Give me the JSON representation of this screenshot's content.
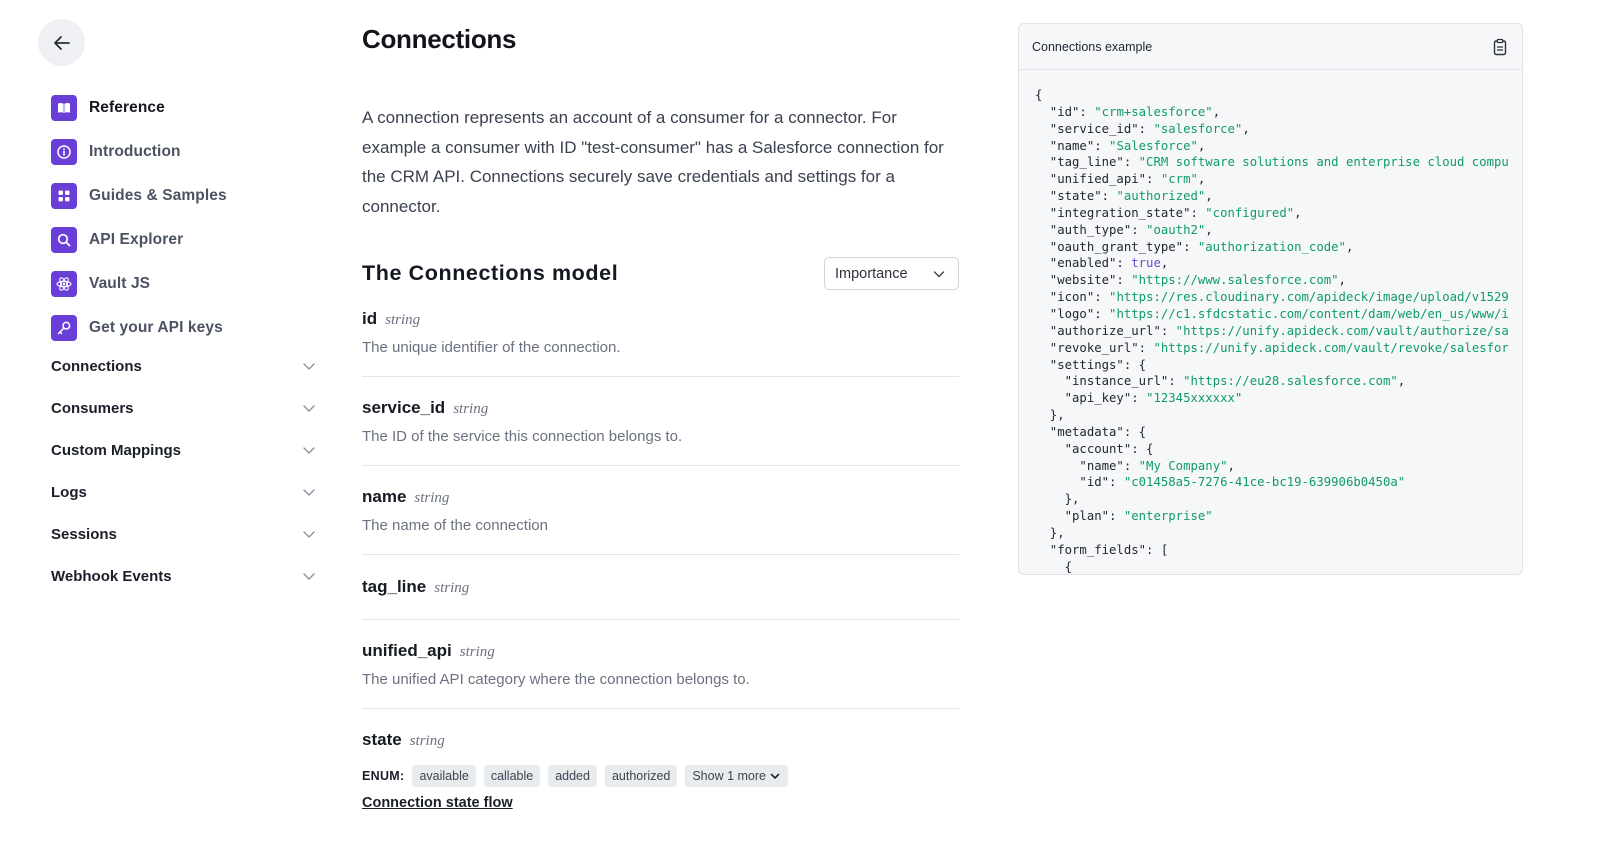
{
  "sidebar": {
    "nav": [
      {
        "label": "Reference",
        "icon": "book-icon",
        "active": true
      },
      {
        "label": "Introduction",
        "icon": "info-icon"
      },
      {
        "label": "Guides & Samples",
        "icon": "grid-icon"
      },
      {
        "label": "API Explorer",
        "icon": "search-icon"
      },
      {
        "label": "Vault JS",
        "icon": "atom-icon"
      },
      {
        "label": "Get your API keys",
        "icon": "key-icon"
      }
    ],
    "groups": [
      {
        "label": "Connections"
      },
      {
        "label": "Consumers"
      },
      {
        "label": "Custom Mappings"
      },
      {
        "label": "Logs"
      },
      {
        "label": "Sessions"
      },
      {
        "label": "Webhook Events"
      }
    ]
  },
  "main": {
    "title": "Connections",
    "intro": "A connection represents an account of a consumer for a connector. For example a consumer with ID \"test-consumer\" has a Salesforce connection for the CRM API. Connections securely save credentials and settings for a connector.",
    "model_title": "The Connections model",
    "sort_select": "Importance",
    "fields": [
      {
        "name": "id",
        "type": "string",
        "desc": "The unique identifier of the connection."
      },
      {
        "name": "service_id",
        "type": "string",
        "desc": "The ID of the service this connection belongs to."
      },
      {
        "name": "name",
        "type": "string",
        "desc": "The name of the connection"
      },
      {
        "name": "tag_line",
        "type": "string",
        "desc": ""
      },
      {
        "name": "unified_api",
        "type": "string",
        "desc": "The unified API category where the connection belongs to."
      },
      {
        "name": "state",
        "type": "string",
        "desc": ""
      }
    ],
    "enum": {
      "label": "ENUM:",
      "values": [
        "available",
        "callable",
        "added",
        "authorized"
      ],
      "more": "Show 1 more"
    },
    "flow_link": "Connection state flow"
  },
  "code_panel": {
    "title": "Connections example",
    "lines": [
      [
        [
          "p",
          "{"
        ]
      ],
      [
        [
          "p",
          "  \"id\": "
        ],
        [
          "s",
          "\"crm+salesforce\""
        ],
        [
          "p",
          ","
        ]
      ],
      [
        [
          "p",
          "  \"service_id\": "
        ],
        [
          "s",
          "\"salesforce\""
        ],
        [
          "p",
          ","
        ]
      ],
      [
        [
          "p",
          "  \"name\": "
        ],
        [
          "s",
          "\"Salesforce\""
        ],
        [
          "p",
          ","
        ]
      ],
      [
        [
          "p",
          "  \"tag_line\": "
        ],
        [
          "s",
          "\"CRM software solutions and enterprise cloud compu"
        ]
      ],
      [
        [
          "p",
          "  \"unified_api\": "
        ],
        [
          "s",
          "\"crm\""
        ],
        [
          "p",
          ","
        ]
      ],
      [
        [
          "p",
          "  \"state\": "
        ],
        [
          "s",
          "\"authorized\""
        ],
        [
          "p",
          ","
        ]
      ],
      [
        [
          "p",
          "  \"integration_state\": "
        ],
        [
          "s",
          "\"configured\""
        ],
        [
          "p",
          ","
        ]
      ],
      [
        [
          "p",
          "  \"auth_type\": "
        ],
        [
          "s",
          "\"oauth2\""
        ],
        [
          "p",
          ","
        ]
      ],
      [
        [
          "p",
          "  \"oauth_grant_type\": "
        ],
        [
          "s",
          "\"authorization_code\""
        ],
        [
          "p",
          ","
        ]
      ],
      [
        [
          "p",
          "  \"enabled\": "
        ],
        [
          "b",
          "true"
        ],
        [
          "p",
          ","
        ]
      ],
      [
        [
          "p",
          "  \"website\": "
        ],
        [
          "s",
          "\"https://www.salesforce.com\""
        ],
        [
          "p",
          ","
        ]
      ],
      [
        [
          "p",
          "  \"icon\": "
        ],
        [
          "s",
          "\"https://res.cloudinary.com/apideck/image/upload/v1529"
        ]
      ],
      [
        [
          "p",
          "  \"logo\": "
        ],
        [
          "s",
          "\"https://c1.sfdcstatic.com/content/dam/web/en_us/www/i"
        ]
      ],
      [
        [
          "p",
          "  \"authorize_url\": "
        ],
        [
          "s",
          "\"https://unify.apideck.com/vault/authorize/sa"
        ]
      ],
      [
        [
          "p",
          "  \"revoke_url\": "
        ],
        [
          "s",
          "\"https://unify.apideck.com/vault/revoke/salesfor"
        ]
      ],
      [
        [
          "p",
          "  \"settings\": {"
        ]
      ],
      [
        [
          "p",
          "    \"instance_url\": "
        ],
        [
          "s",
          "\"https://eu28.salesforce.com\""
        ],
        [
          "p",
          ","
        ]
      ],
      [
        [
          "p",
          "    \"api_key\": "
        ],
        [
          "s",
          "\"12345xxxxxx\""
        ]
      ],
      [
        [
          "p",
          "  },"
        ]
      ],
      [
        [
          "p",
          "  \"metadata\": {"
        ]
      ],
      [
        [
          "p",
          "    \"account\": {"
        ]
      ],
      [
        [
          "p",
          "      \"name\": "
        ],
        [
          "s",
          "\"My Company\""
        ],
        [
          "p",
          ","
        ]
      ],
      [
        [
          "p",
          "      \"id\": "
        ],
        [
          "s",
          "\"c01458a5-7276-41ce-bc19-639906b0450a\""
        ]
      ],
      [
        [
          "p",
          "    },"
        ]
      ],
      [
        [
          "p",
          "    \"plan\": "
        ],
        [
          "s",
          "\"enterprise\""
        ]
      ],
      [
        [
          "p",
          "  },"
        ]
      ],
      [
        [
          "p",
          "  \"form_fields\": ["
        ]
      ],
      [
        [
          "p",
          "    {"
        ]
      ]
    ]
  },
  "colors": {
    "accent": "#6a3fd8",
    "code_string": "#0f9b6c",
    "code_boolean": "#6b4bd0"
  }
}
